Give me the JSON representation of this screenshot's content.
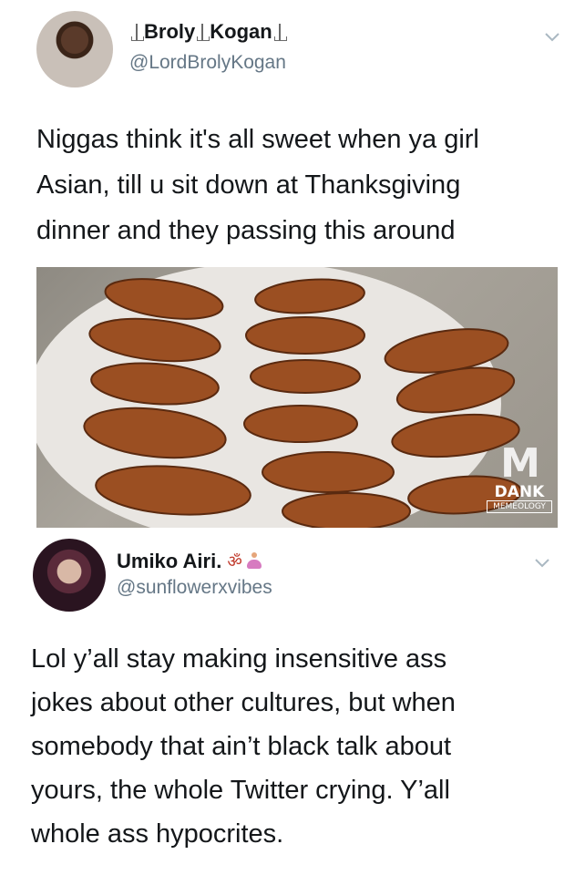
{
  "tweet1": {
    "display_name_a": "Broly",
    "display_name_b": "Kogan",
    "handle": "@LordBrolyKogan",
    "text_lines": [
      "Niggas think it's all sweet when ya girl",
      "Asian, till u sit down at Thanksgiving",
      "dinner and they passing this around"
    ],
    "avatar_icon": "profile-photo-man",
    "menu_icon": "chevron-down-icon"
  },
  "image": {
    "subject": "roasted-rats-on-plate",
    "watermark_logo": "M",
    "watermark_line1": "DANK",
    "watermark_line2": "MEMEOLOGY"
  },
  "tweet2": {
    "display_name": "Umiko Airi.",
    "name_emoji": "ॐ",
    "handle": "@sunflowerxvibes",
    "text_lines": [
      "Lol y’all stay making insensitive ass",
      "jokes about other cultures, but when",
      "somebody that ain’t black talk about",
      "yours, the whole Twitter crying. Y’all",
      "whole ass hypocrites."
    ],
    "avatar_icon": "profile-photo-woman",
    "menu_icon": "chevron-down-icon"
  },
  "colors": {
    "text": "#14171a",
    "handle": "#657786",
    "chevron": "#aab8c2"
  }
}
